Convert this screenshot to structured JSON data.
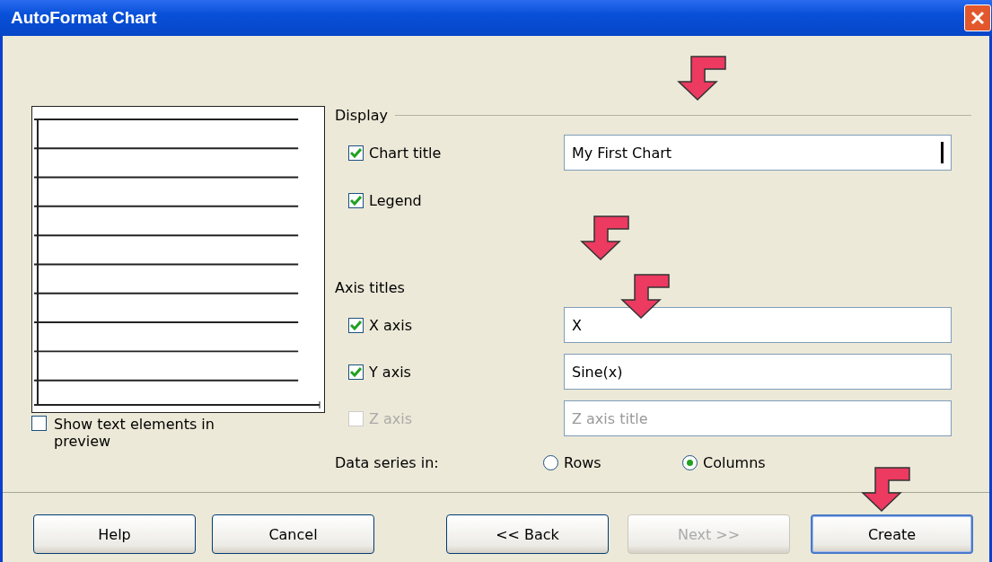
{
  "window": {
    "title": "AutoFormat Chart"
  },
  "preview": {
    "show_text": {
      "label": "Show text elements in preview",
      "checked": false
    }
  },
  "display": {
    "heading": "Display",
    "items": [
      {
        "kind": "field",
        "label": "Chart title",
        "checked": true,
        "disabled": false,
        "value": "My First Chart",
        "caret": true
      },
      {
        "kind": "check",
        "label": "Legend",
        "checked": true,
        "disabled": false
      }
    ]
  },
  "axis_titles": {
    "heading": "Axis titles",
    "items": [
      {
        "kind": "field",
        "label": "X axis",
        "checked": true,
        "disabled": false,
        "value": "X"
      },
      {
        "kind": "field",
        "label": "Y axis",
        "checked": true,
        "disabled": false,
        "value": "Sine(x)"
      },
      {
        "kind": "field",
        "label": "Z axis",
        "checked": false,
        "disabled": true,
        "placeholder": "Z axis title"
      }
    ]
  },
  "data_series": {
    "label": "Data series in:",
    "options": [
      {
        "label": "Rows",
        "selected": false
      },
      {
        "label": "Columns",
        "selected": true
      }
    ]
  },
  "buttons": [
    {
      "label": "Help",
      "disabled": false,
      "default": false
    },
    {
      "label": "Cancel",
      "disabled": false,
      "default": false
    },
    {
      "label": "<< Back",
      "disabled": false,
      "default": false
    },
    {
      "label": "Next >>",
      "disabled": true,
      "default": false
    },
    {
      "label": "Create",
      "disabled": false,
      "default": true
    }
  ]
}
